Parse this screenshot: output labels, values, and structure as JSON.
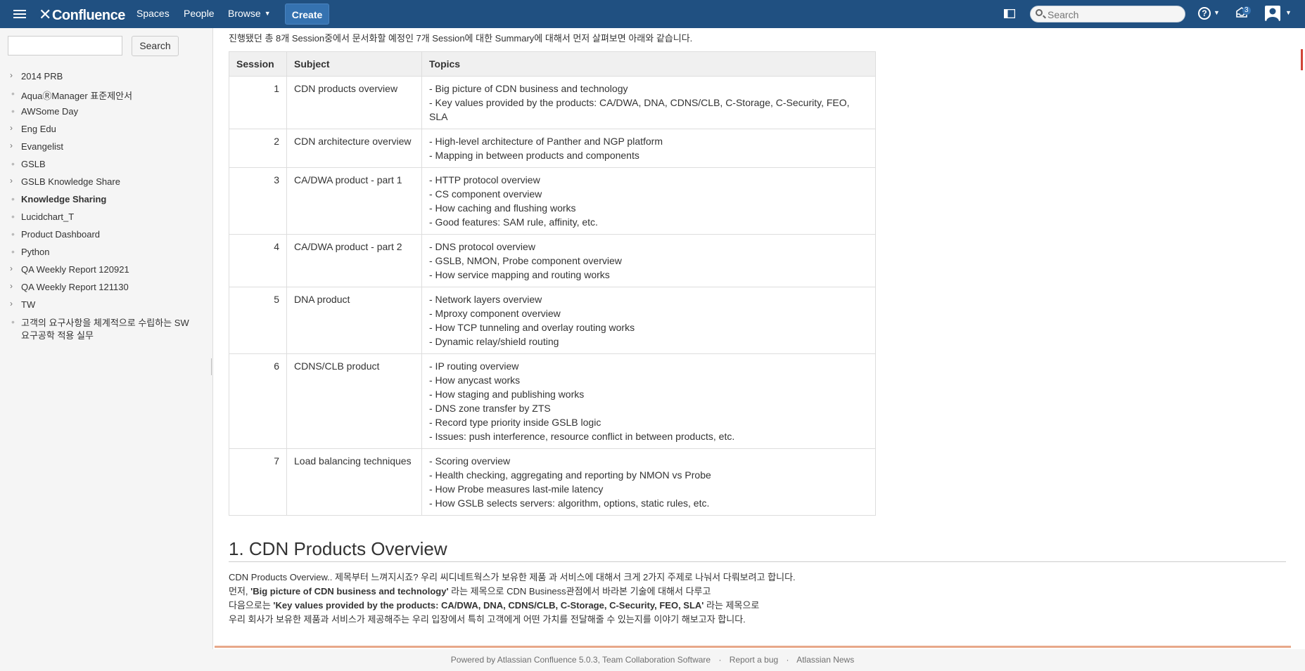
{
  "header": {
    "logo": "Confluence",
    "nav": [
      "Spaces",
      "People",
      "Browse"
    ],
    "create_label": "Create",
    "search_placeholder": "Search",
    "notification_count": "3"
  },
  "sidebar": {
    "search_button": "Search",
    "items": [
      {
        "label": "2014 PRB",
        "marker": "›",
        "bold": false
      },
      {
        "label": "AquaⓇManager 표준제안서",
        "marker": "•",
        "bold": false
      },
      {
        "label": "AWSome Day",
        "marker": "•",
        "bold": false
      },
      {
        "label": "Eng Edu",
        "marker": "›",
        "bold": false
      },
      {
        "label": "Evangelist",
        "marker": "›",
        "bold": false
      },
      {
        "label": "GSLB",
        "marker": "•",
        "bold": false
      },
      {
        "label": "GSLB Knowledge Share",
        "marker": "›",
        "bold": false
      },
      {
        "label": "Knowledge Sharing",
        "marker": "•",
        "bold": true
      },
      {
        "label": "Lucidchart_T",
        "marker": "•",
        "bold": false
      },
      {
        "label": "Product Dashboard",
        "marker": "•",
        "bold": false
      },
      {
        "label": "Python",
        "marker": "•",
        "bold": false
      },
      {
        "label": "QA Weekly Report 120921",
        "marker": "›",
        "bold": false
      },
      {
        "label": "QA Weekly Report 121130",
        "marker": "›",
        "bold": false
      },
      {
        "label": "TW",
        "marker": "›",
        "bold": false
      },
      {
        "label": "고객의 요구사항을 체계적으로 수립하는 SW",
        "label2": "요구공학 적용 실무",
        "marker": "•",
        "bold": false
      }
    ]
  },
  "main": {
    "intro": "진행됐던 총 8개 Session중에서 문서화할 예정인 7개 Session에 대한 Summary에 대해서 먼저 살펴보면 아래와 같습니다.",
    "table": {
      "headers": [
        "Session",
        "Subject",
        "Topics"
      ],
      "rows": [
        {
          "session": "1",
          "subject": "CDN products overview",
          "topics": [
            "- Big picture of CDN business and technology",
            "- Key values provided by the products: CA/DWA, DNA, CDNS/CLB, C-Storage, C-Security, FEO, SLA"
          ]
        },
        {
          "session": "2",
          "subject": "CDN architecture overview",
          "topics": [
            "- High-level architecture of Panther and NGP platform",
            "- Mapping in between products and components"
          ]
        },
        {
          "session": "3",
          "subject": "CA/DWA product - part 1",
          "topics": [
            "- HTTP protocol overview",
            "- CS component overview",
            "- How caching and flushing works",
            "- Good features: SAM rule, affinity, etc."
          ]
        },
        {
          "session": "4",
          "subject": "CA/DWA product - part 2",
          "topics": [
            "- DNS protocol overview",
            "- GSLB, NMON, Probe component overview",
            "- How service mapping and routing works"
          ]
        },
        {
          "session": "5",
          "subject": "DNA product",
          "topics": [
            "- Network layers overview",
            "- Mproxy component overview",
            "- How TCP tunneling and overlay routing works",
            "- Dynamic relay/shield routing"
          ]
        },
        {
          "session": "6",
          "subject": "CDNS/CLB product",
          "topics": [
            "- IP routing overview",
            "- How anycast works",
            "- How staging and publishing works",
            "- DNS zone transfer by ZTS",
            "- Record type priority inside GSLB logic",
            "- Issues: push interference, resource conflict in between products, etc."
          ]
        },
        {
          "session": "7",
          "subject": "Load balancing techniques",
          "topics": [
            "- Scoring overview",
            "- Health checking, aggregating and reporting by NMON vs Probe",
            "- How Probe measures last-mile latency",
            "- How GSLB selects servers: algorithm, options, static rules, etc."
          ]
        }
      ]
    },
    "section_title": "1. CDN Products Overview",
    "para": {
      "line1": "CDN Products Overview.. 제목부터 느껴지시죠? 우리 씨디네트웍스가 보유한 제품 과 서비스에 대해서 크게 2가지 주제로 나눠서 다뤄보려고 합니다.",
      "line2_pre": "먼저, ",
      "line2_bold": "'Big picture of CDN business and technology'",
      "line2_post": " 라는 제목으로 CDN Business관점에서 바라본 기술에 대해서 다루고",
      "line3_pre": "다음으로는 ",
      "line3_bold": "'Key values provided by the products: CA/DWA, DNA, CDNS/CLB, C-Storage, C-Security, FEO, SLA'",
      "line3_post": " 라는 제목으로",
      "line4": "우리 회사가 보유한 제품과 서비스가 제공해주는 우리 입장에서 특히 고객에게 어떤 가치를 전달해줄 수 있는지를 이야기 해보고자 합니다."
    }
  },
  "footer": {
    "powered": "Powered by Atlassian Confluence 5.0.3, Team Collaboration Software",
    "report": "Report a bug",
    "news": "Atlassian News",
    "sep": "·"
  }
}
